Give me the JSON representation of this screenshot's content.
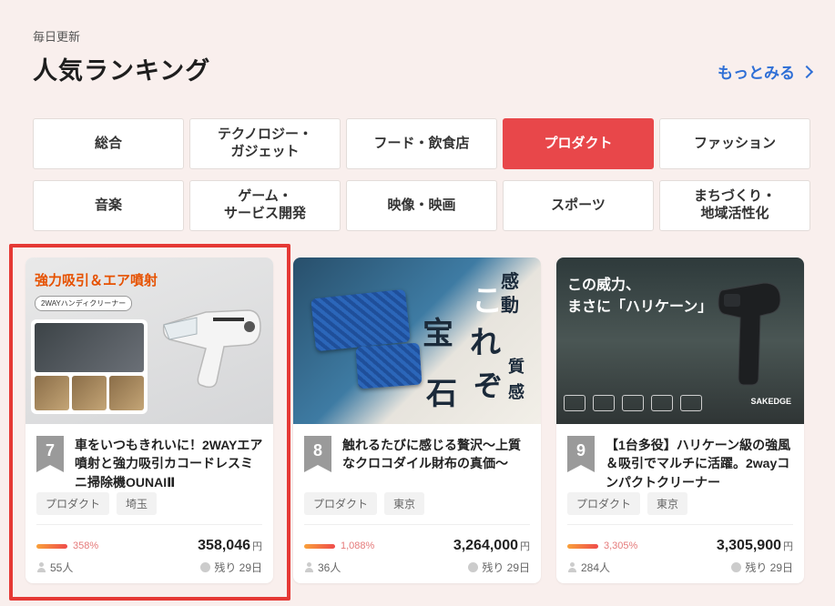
{
  "header": {
    "daily_label": "毎日更新",
    "title": "人気ランキング",
    "more_label": "もっとみる"
  },
  "categories": [
    {
      "label": "総合",
      "active": false
    },
    {
      "label": "テクノロジー・\nガジェット",
      "active": false
    },
    {
      "label": "フード・飲食店",
      "active": false
    },
    {
      "label": "プロダクト",
      "active": true
    },
    {
      "label": "ファッション",
      "active": false
    },
    {
      "label": "音楽",
      "active": false
    },
    {
      "label": "ゲーム・\nサービス開発",
      "active": false
    },
    {
      "label": "映像・映画",
      "active": false
    },
    {
      "label": "スポーツ",
      "active": false
    },
    {
      "label": "まちづくり・\n地域活性化",
      "active": false
    }
  ],
  "colors": {
    "accent": "#e8474a",
    "link": "#2f6fd6",
    "highlight": "#e53935",
    "background": "#f9efed"
  },
  "cards": [
    {
      "rank": "7",
      "title": "車をいつもきれいに！2WAYエア噴射と強力吸引カコードレスミニ掃除機OUNAIⅡ",
      "tags": [
        "プロダクト",
        "埼玉"
      ],
      "percent": "358%",
      "amount": "358,046",
      "currency": "円",
      "supporters": "55人",
      "remaining": "残り 29日",
      "thumb": {
        "headline": "強力吸引＆エア噴射",
        "sub": "2WAYハンディクリーナー"
      }
    },
    {
      "rank": "8",
      "title": "触れるたびに感じる贅沢～上質なクロコダイル財布の真価～",
      "tags": [
        "プロダクト",
        "東京"
      ],
      "percent": "1,088%",
      "amount": "3,264,000",
      "currency": "円",
      "supporters": "36人",
      "remaining": "残り 29日",
      "thumb": {
        "kanji_1": "感",
        "kanji_2": "動",
        "kanji_3": "こ",
        "kanji_4": "宝",
        "kanji_5": "れ",
        "kanji_6": "石",
        "kanji_7": "ぞ",
        "kanji_8": "質",
        "kanji_9": "感"
      }
    },
    {
      "rank": "9",
      "title": "【1台多役】ハリケーン級の強風＆吸引でマルチに活躍。2wayコンパクトクリーナー",
      "tags": [
        "プロダクト",
        "東京"
      ],
      "percent": "3,305%",
      "amount": "3,305,900",
      "currency": "円",
      "supporters": "284人",
      "remaining": "残り 29日",
      "thumb": {
        "line_1": "この威力、",
        "line_2": "まさに「ハリケーン」",
        "brand": "SAKEDGE"
      }
    }
  ]
}
